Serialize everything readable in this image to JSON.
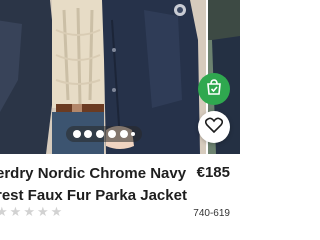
{
  "product": {
    "title": "erdry Nordic Chrome Navy\nrest Faux Fur Parka Jacket",
    "price": "€185",
    "rating": {
      "stars_filled": 0,
      "stars_total": 5
    },
    "sku": "740-619"
  },
  "gallery": {
    "dot_count": 6,
    "active_index": 0
  },
  "buttons": {
    "save_icon": "shopping-bag-check-icon",
    "wishlist_icon": "heart-icon"
  },
  "colors": {
    "accent_green": "#2fa84f",
    "text": "#1e1e1e",
    "star_empty": "#d2d2d2"
  }
}
